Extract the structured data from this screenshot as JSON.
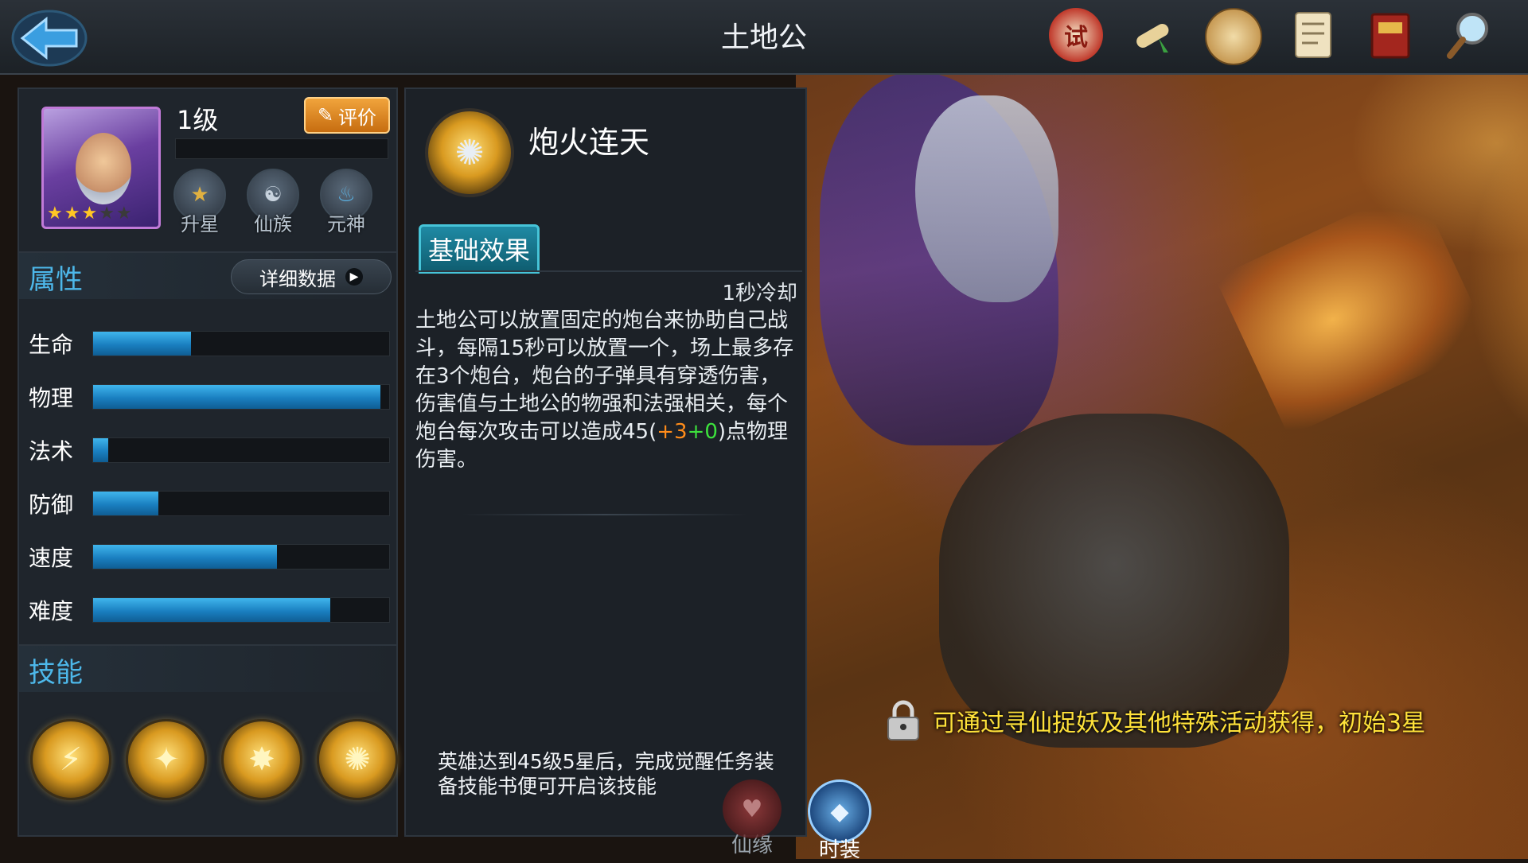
{
  "window": {
    "title": "土地公"
  },
  "topbar": {
    "icons": [
      {
        "name": "trial-icon",
        "glyph": "试"
      },
      {
        "name": "scroll-icon",
        "glyph": ""
      },
      {
        "name": "token-icon",
        "glyph": ""
      },
      {
        "name": "document-icon",
        "glyph": ""
      },
      {
        "name": "book-icon",
        "glyph": ""
      },
      {
        "name": "search-icon",
        "glyph": ""
      }
    ]
  },
  "hero": {
    "level": "1级",
    "rate_label": "评价",
    "stars": 3,
    "max_stars": 5,
    "badges": [
      {
        "label": "升星",
        "icon": "star-upgrade-icon"
      },
      {
        "label": "仙族",
        "icon": "clan-icon"
      },
      {
        "label": "元神",
        "icon": "spirit-icon"
      }
    ]
  },
  "attributes": {
    "title": "属性",
    "detail_button": "详细数据",
    "items": [
      {
        "label": "生命",
        "value": 0.33
      },
      {
        "label": "物理",
        "value": 0.97
      },
      {
        "label": "法术",
        "value": 0.05
      },
      {
        "label": "防御",
        "value": 0.22
      },
      {
        "label": "速度",
        "value": 0.62
      },
      {
        "label": "难度",
        "value": 0.8
      }
    ]
  },
  "skills": {
    "title": "技能",
    "items": [
      {
        "name": "skill-1-icon",
        "glyph": ""
      },
      {
        "name": "skill-2-icon",
        "glyph": ""
      },
      {
        "name": "skill-3-icon",
        "glyph": ""
      },
      {
        "name": "skill-4-icon",
        "glyph": ""
      }
    ]
  },
  "skill_detail": {
    "name": "炮火连天",
    "tab_label": "基础效果",
    "cooldown": "1秒冷却",
    "description_main": "土地公可以放置固定的炮台来协助自己战斗，每隔15秒可以放置一个，场上最多存在3个炮台，炮台的子弹具有穿透伤害，伤害值与土地公的物强和法强相关，每个炮台每次攻击可以造成45(",
    "description_plus": "+3",
    "description_bonus": "+0",
    "description_end": ")点物理伤害。",
    "unlock_text": "英雄达到45级5星后，完成觉醒任务装备技能书便可开启该技能"
  },
  "bottom_tabs": [
    {
      "label": "仙缘",
      "active": false
    },
    {
      "label": "时装",
      "active": true
    }
  ],
  "notice": {
    "text": "可通过寻仙捉妖及其他特殊活动获得，初始3星"
  },
  "colors": {
    "accent_blue": "#4db8ea",
    "bar_blue": "#1a7fc0",
    "gold": "#ffe23a",
    "orange": "#ff8c1a",
    "green": "#3de23d"
  }
}
